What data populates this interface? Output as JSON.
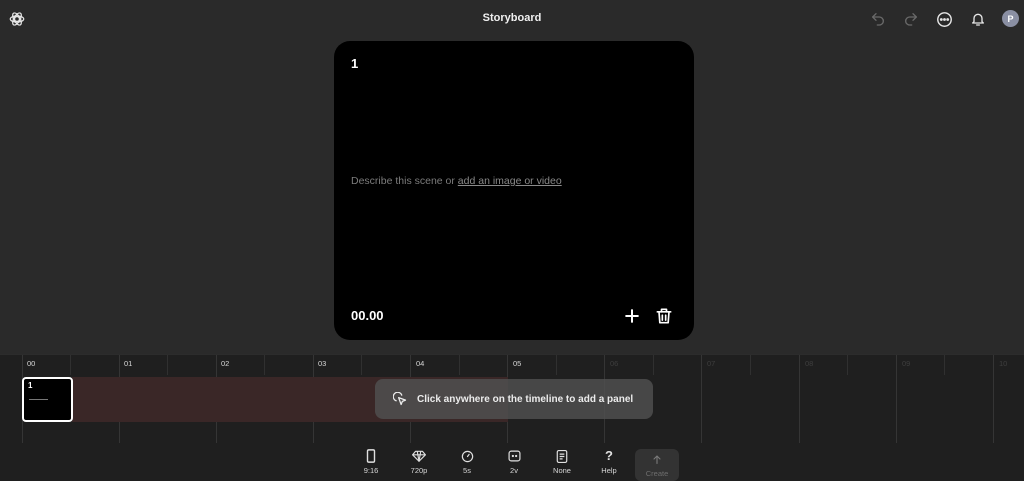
{
  "header": {
    "title": "Storyboard",
    "avatar_initial": "P",
    "icons": [
      "openai-logo-icon",
      "undo-icon",
      "redo-icon",
      "more-icon",
      "bell-icon"
    ]
  },
  "scene": {
    "number": "1",
    "prompt_prefix": "Describe this scene or ",
    "prompt_link": "add an image or video",
    "time": "00.00"
  },
  "timeline": {
    "ticks": [
      "00",
      "01",
      "02",
      "03",
      "04",
      "05",
      "06",
      "07",
      "08",
      "09",
      "10"
    ],
    "panel_number": "1",
    "hint": "Click anywhere on the timeline to add a panel"
  },
  "toolbar": {
    "aspect_label": "9:16",
    "resolution_label": "720p",
    "duration_label": "5s",
    "variations_label": "2v",
    "style_label": "None",
    "help_label": "Help",
    "create_label": "Create"
  },
  "colors": {
    "background": "#2a2a2a",
    "card": "#000000",
    "timeline": "#1f1f1f",
    "range": "#3a2727",
    "avatar": "#8a8fa3"
  }
}
